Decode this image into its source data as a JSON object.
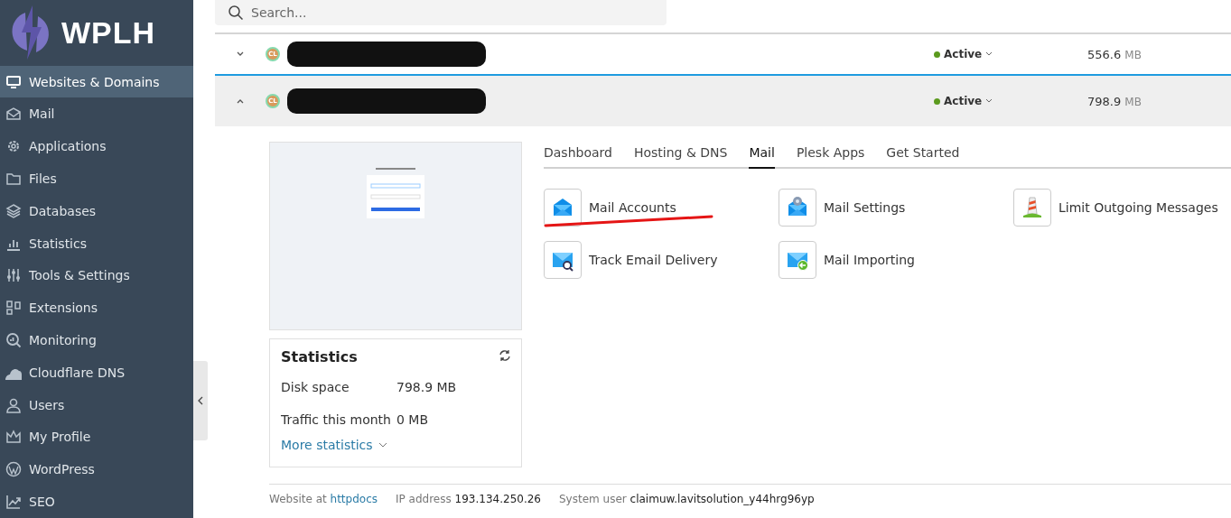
{
  "logo": {
    "text": "WPLH"
  },
  "sidebar": {
    "items": [
      {
        "label": "Websites & Domains",
        "selected": true
      },
      {
        "label": "Mail",
        "selected": false
      },
      {
        "label": "Applications",
        "selected": false
      },
      {
        "label": "Files",
        "selected": false
      },
      {
        "label": "Databases",
        "selected": false
      },
      {
        "label": "Statistics",
        "selected": false
      },
      {
        "label": "Tools & Settings",
        "selected": false
      },
      {
        "label": "Extensions",
        "selected": false
      },
      {
        "label": "Monitoring",
        "selected": false
      },
      {
        "label": "Cloudflare DNS",
        "selected": false
      },
      {
        "label": "Users",
        "selected": false
      },
      {
        "label": "My Profile",
        "selected": false
      },
      {
        "label": "WordPress",
        "selected": false
      },
      {
        "label": "SEO",
        "selected": false
      }
    ]
  },
  "search": {
    "placeholder": "Search..."
  },
  "domains": [
    {
      "avatar": "CL",
      "status": "Active",
      "size": "556.6",
      "unit": "MB",
      "expanded": false
    },
    {
      "avatar": "CL",
      "status": "Active",
      "size": "798.9",
      "unit": "MB",
      "expanded": true
    }
  ],
  "detail": {
    "tabs": [
      {
        "label": "Dashboard",
        "selected": false
      },
      {
        "label": "Hosting & DNS",
        "selected": false
      },
      {
        "label": "Mail",
        "selected": true
      },
      {
        "label": "Plesk Apps",
        "selected": false
      },
      {
        "label": "Get Started",
        "selected": false
      }
    ],
    "tools": [
      {
        "label": "Mail Accounts"
      },
      {
        "label": "Mail Settings"
      },
      {
        "label": "Limit Outgoing Messages"
      },
      {
        "label": "Track Email Delivery"
      },
      {
        "label": "Mail Importing"
      }
    ],
    "statistics": {
      "title": "Statistics",
      "rows": [
        {
          "label": "Disk space",
          "value": "798.9 MB"
        },
        {
          "label": "Traffic this month",
          "value": "0 MB"
        }
      ],
      "more": "More statistics"
    },
    "footer": [
      {
        "label": "Website at",
        "value": "httpdocs",
        "kind": "link"
      },
      {
        "label": "IP address",
        "value": "193.134.250.26",
        "kind": "text"
      },
      {
        "label": "System user",
        "value": "claimuw.lavitsolution_y44hrg96yp",
        "kind": "text"
      }
    ]
  }
}
